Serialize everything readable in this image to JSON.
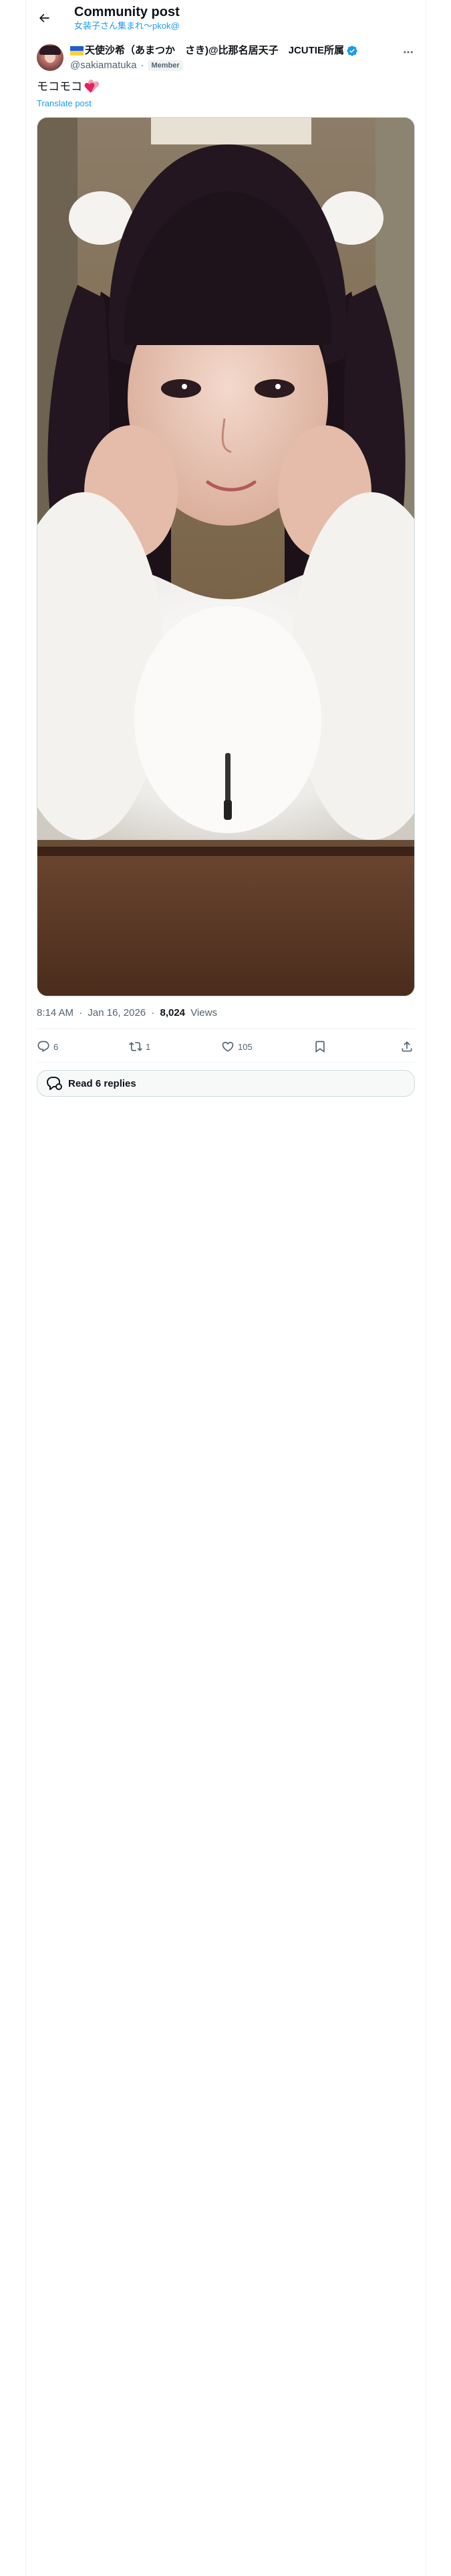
{
  "header": {
    "title": "Community post",
    "community_name": "女装子さん集まれ〜pkok@",
    "back_icon": "arrow-left-icon"
  },
  "author": {
    "display_name": "天使沙希（あまつか　さき)@比那名居天子　JCUTIE所属",
    "handle": "@sakiamatuka",
    "separator": "·",
    "role_badge": "Member",
    "verified": true,
    "flag_icon": "flag-icon",
    "verified_color": "#1d9bf0"
  },
  "post": {
    "text": "モコモコ",
    "emoji": "hearts-icon",
    "translate_label": "Translate post",
    "time": "8:14 AM",
    "date": "Jan 16, 2026",
    "dot": "·",
    "views_count": "8,024",
    "views_label": "Views"
  },
  "actions": {
    "replies": "6",
    "reposts": "1",
    "likes": "105",
    "bookmark_icon": "bookmark-icon",
    "share_icon": "share-icon"
  },
  "replies_button": {
    "label": "Read 6 replies"
  },
  "colors": {
    "accent": "#1d9bf0",
    "text_primary": "#0f1419",
    "text_secondary": "#536471",
    "border": "#cfd9de"
  }
}
